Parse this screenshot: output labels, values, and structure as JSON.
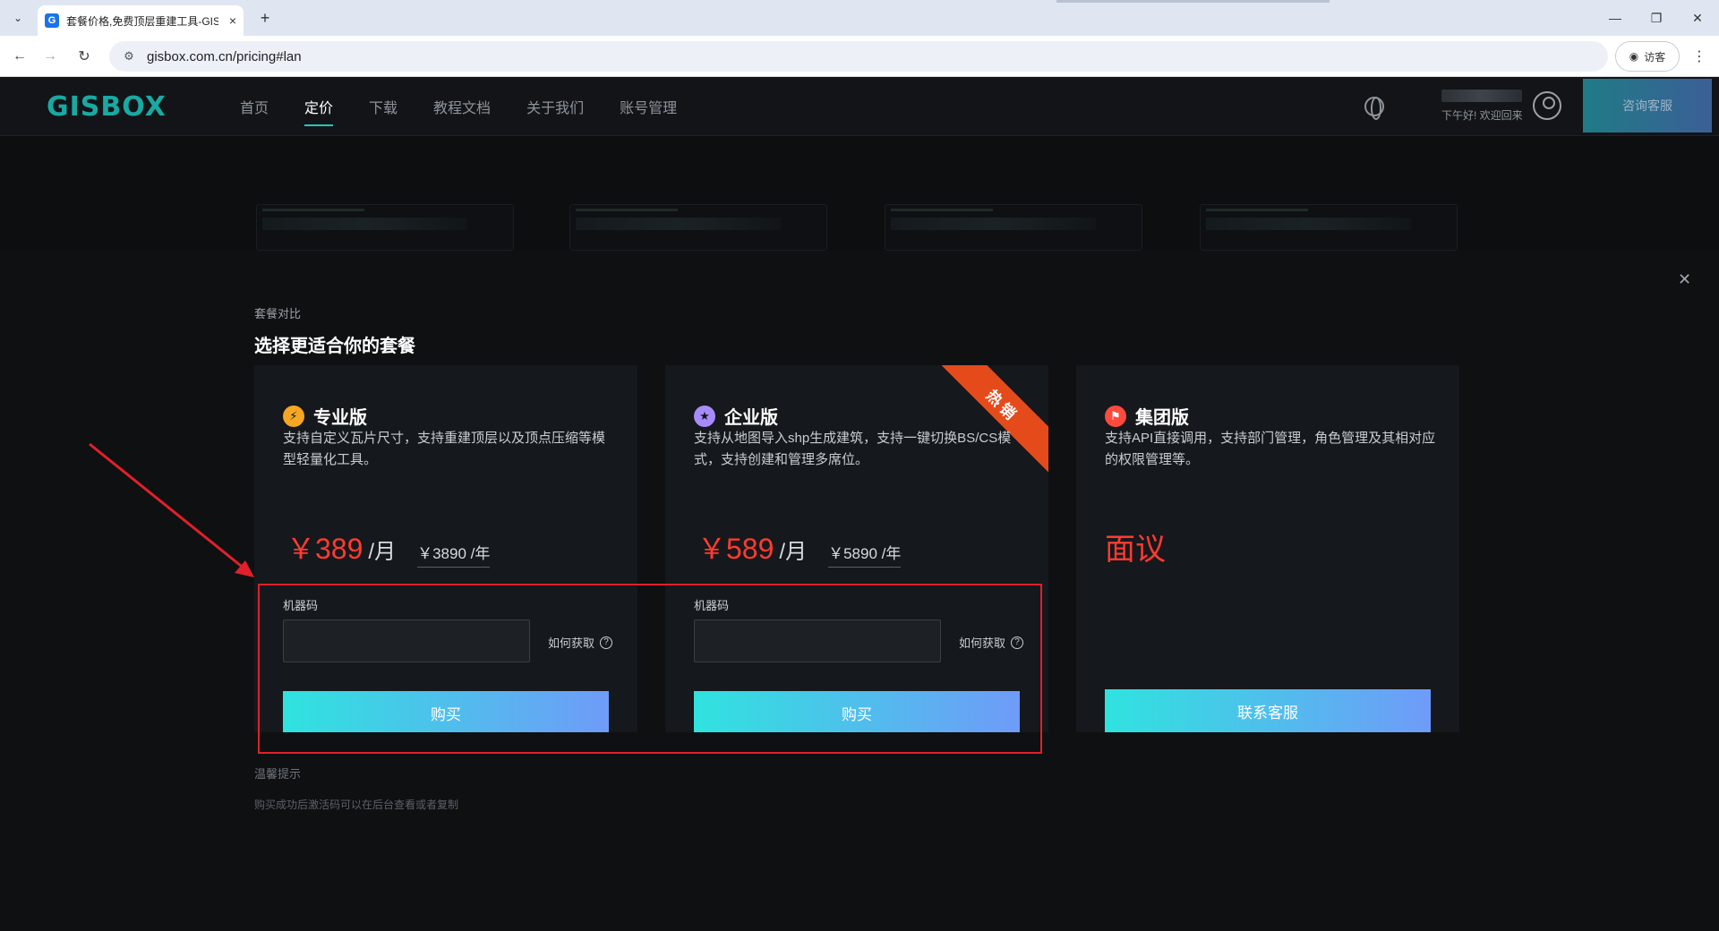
{
  "browser": {
    "tab_title": "套餐价格,免费顶层重建工具-GISBox",
    "favicon_letter": "G",
    "url": "gisbox.com.cn/pricing#lan",
    "visitor_label": "访客"
  },
  "header": {
    "logo": "GISBOX",
    "nav": [
      "首页",
      "定价",
      "下载",
      "教程文档",
      "关于我们",
      "账号管理"
    ],
    "greeting": "下午好! 欢迎回来",
    "consult_button": "咨询客服"
  },
  "modal": {
    "subtitle": "套餐对比",
    "title": "选择更适合你的套餐",
    "plans": [
      {
        "name": "专业版",
        "icon": "lightning-icon",
        "icon_color": "#f5a623",
        "description": "支持自定义瓦片尺寸，支持重建顶层以及顶点压缩等模型轻量化工具。",
        "price": "￥389",
        "unit": "/月",
        "yearly": "￥3890 /年",
        "field_label": "机器码",
        "how_to_get": "如何获取",
        "button": "购买"
      },
      {
        "name": "企业版",
        "icon": "medal-icon",
        "icon_color": "#a78bfa",
        "description": "支持从地图导入shp生成建筑，支持一键切换BS/CS模式，支持创建和管理多席位。",
        "price": "￥589",
        "unit": "/月",
        "yearly": "￥5890 /年",
        "field_label": "机器码",
        "how_to_get": "如何获取",
        "button": "购买",
        "ribbon": "热销"
      },
      {
        "name": "集团版",
        "icon": "flag-icon",
        "icon_color": "#ff4a3d",
        "description": "支持API直接调用，支持部门管理，角色管理及其相对应的权限管理等。",
        "price_text": "面议",
        "button": "联系客服"
      }
    ],
    "tip_title": "温馨提示",
    "tip_text": "购买成功后激活码可以在后台查看或者复制"
  },
  "colors": {
    "accent_teal": "#22c7c1",
    "price_red": "#ff3b30",
    "annotation_red": "#e0202a"
  }
}
